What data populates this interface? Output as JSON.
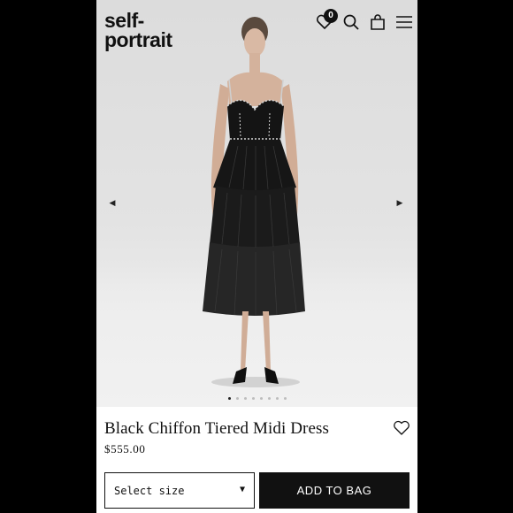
{
  "brand": {
    "line1": "self-",
    "line2": "portrait"
  },
  "header": {
    "wishlist_count": "0",
    "icons": [
      "heart-icon",
      "search-icon",
      "bag-icon",
      "menu-icon"
    ]
  },
  "carousel": {
    "slide_count": 8,
    "active_index": 0
  },
  "product": {
    "title": "Black Chiffon Tiered Midi Dress",
    "price": "$555.00"
  },
  "actions": {
    "select_size_label": "Select size",
    "add_to_bag_label": "ADD TO BAG"
  },
  "colors": {
    "accent": "#111111",
    "background": "#ffffff",
    "photo_bg": "#e2e2e2"
  }
}
